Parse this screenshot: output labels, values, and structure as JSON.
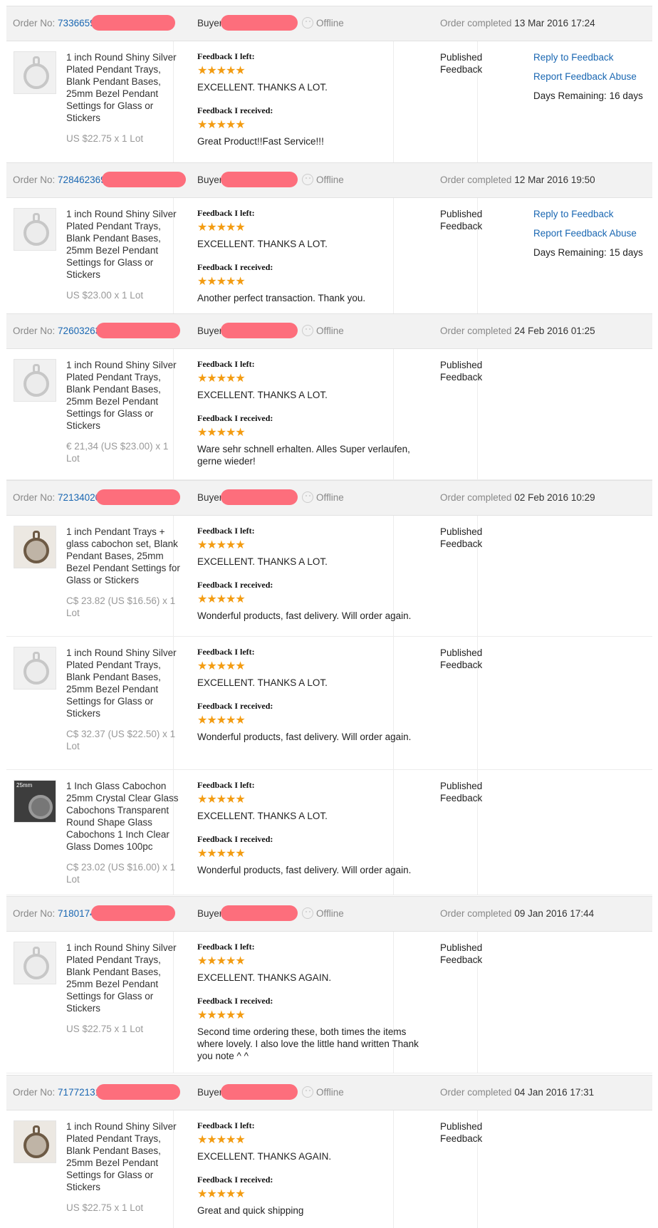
{
  "labels": {
    "order_no": "Order No:",
    "buyer": "Buyer:",
    "offline": "Offline",
    "order_completed": "Order completed",
    "feedback_left": "Feedback I left:",
    "feedback_received": "Feedback I received:",
    "status": "Published Feedback",
    "reply": "Reply to Feedback",
    "report": "Report Feedback Abuse",
    "days_remaining_prefix": "Days Remaining:",
    "stars": "★★★★★"
  },
  "orders": [
    {
      "order_no_visible": "7336659",
      "date": "13 Mar 2016 17:24",
      "days_remaining": "16 days",
      "items": [
        {
          "title": "1 inch Round Shiny Silver Plated Pendant Trays, Blank Pendant Bases, 25mm Bezel Pendant Settings for Glass or Stickers",
          "price": "US $22.75 x 1 Lot",
          "thumb": "silver",
          "left_stars": 5,
          "left_text": "EXCELLENT. THANKS A LOT.",
          "received_stars": 5,
          "received_text": "Great Product!!Fast Service!!!"
        }
      ]
    },
    {
      "order_no_visible": "728462369",
      "date": "12 Mar 2016 19:50",
      "days_remaining": "15 days",
      "items": [
        {
          "title": "1 inch Round Shiny Silver Plated Pendant Trays, Blank Pendant Bases, 25mm Bezel Pendant Settings for Glass or Stickers",
          "price": "US $23.00 x 1 Lot",
          "thumb": "silver",
          "left_stars": 5,
          "left_text": "EXCELLENT. THANKS A LOT.",
          "received_stars": 5,
          "received_text": "Another perfect transaction. Thank you."
        }
      ]
    },
    {
      "order_no_visible": "72603263",
      "date": "24 Feb 2016 01:25",
      "days_remaining": "",
      "items": [
        {
          "title": "1 inch Round Shiny Silver Plated Pendant Trays, Blank Pendant Bases, 25mm Bezel Pendant Settings for Glass or Stickers",
          "price": "€ 21,34 (US $23.00) x 1 Lot",
          "thumb": "silver",
          "left_stars": 5,
          "left_text": "EXCELLENT. THANKS A LOT.",
          "received_stars": 5,
          "received_text": "Ware sehr schnell erhalten. Alles Super verlaufen, gerne wieder!"
        }
      ]
    },
    {
      "order_no_visible": "72134020",
      "date": "02 Feb 2016 10:29",
      "days_remaining": "",
      "items": [
        {
          "title": "1 inch Pendant Trays + glass cabochon set, Blank Pendant Bases, 25mm Bezel Pendant Settings for Glass or Stickers",
          "price": "C$ 23.82 (US $16.56) x 1 Lot",
          "thumb": "bronze",
          "left_stars": 5,
          "left_text": "EXCELLENT. THANKS A LOT.",
          "received_stars": 5,
          "received_text": "Wonderful products, fast delivery. Will order again."
        },
        {
          "title": "1 inch Round Shiny Silver Plated Pendant Trays, Blank Pendant Bases, 25mm Bezel Pendant Settings for Glass or Stickers",
          "price": "C$ 32.37 (US $22.50) x 1 Lot",
          "thumb": "silver",
          "left_stars": 5,
          "left_text": "EXCELLENT. THANKS A LOT.",
          "received_stars": 5,
          "received_text": "Wonderful products, fast delivery. Will order again."
        },
        {
          "title": "1 Inch Glass Cabochon 25mm Crystal Clear Glass Cabochons Transparent Round Shape Glass Cabochons 1 Inch Clear Glass Domes 100pc",
          "price": "C$ 23.02 (US $16.00) x 1 Lot",
          "thumb": "dark",
          "thumb_tag": "25mm",
          "left_stars": 5,
          "left_text": "EXCELLENT. THANKS A LOT.",
          "received_stars": 5,
          "received_text": "Wonderful products, fast delivery. Will order again."
        }
      ]
    },
    {
      "order_no_visible": "7180174",
      "date": "09 Jan 2016 17:44",
      "days_remaining": "",
      "items": [
        {
          "title": "1 inch Round Shiny Silver Plated Pendant Trays, Blank Pendant Bases, 25mm Bezel Pendant Settings for Glass or Stickers",
          "price": "US $22.75 x 1 Lot",
          "thumb": "silver",
          "left_stars": 5,
          "left_text": "EXCELLENT. THANKS AGAIN.",
          "received_stars": 5,
          "received_text": "Second time ordering these, both times the items where lovely. I also love the little hand written Thank you note ^ ^"
        }
      ]
    },
    {
      "order_no_visible": "71772131",
      "date": "04 Jan 2016 17:31",
      "days_remaining": "",
      "items": [
        {
          "title": "1 inch Round Shiny Silver Plated Pendant Trays, Blank Pendant Bases, 25mm Bezel Pendant Settings for Glass or Stickers",
          "price": "US $22.75 x 1 Lot",
          "thumb": "bronze",
          "left_stars": 5,
          "left_text": "EXCELLENT. THANKS AGAIN.",
          "received_stars": 5,
          "received_text": "Great and quick shipping"
        }
      ]
    }
  ]
}
